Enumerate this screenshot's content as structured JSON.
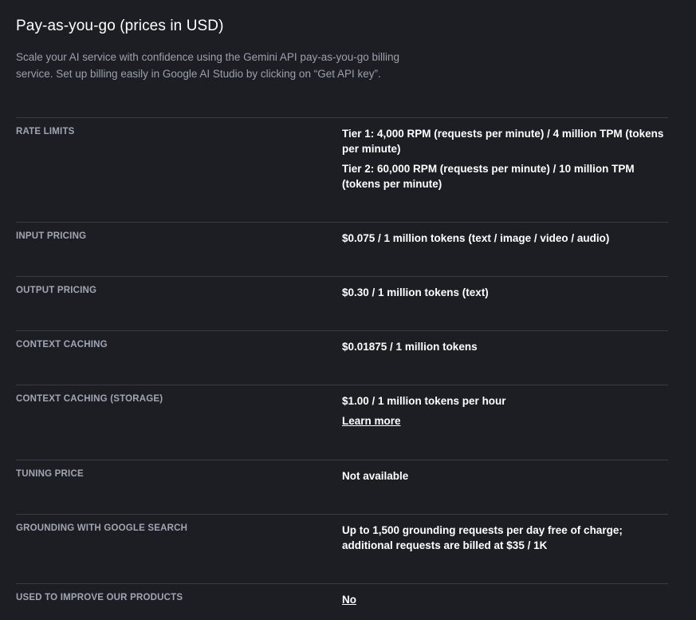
{
  "header": {
    "title": "Pay-as-you-go (prices in USD)",
    "intro": "Scale your AI service with confidence using the Gemini API pay-as-you-go billing service. Set up billing easily in Google AI Studio by clicking on “Get API key”."
  },
  "rows": {
    "rate_limits": {
      "label": "RATE LIMITS",
      "tier1": "Tier 1: 4,000 RPM (requests per minute) / 4 million TPM (tokens per minute)",
      "tier2": "Tier 2: 60,000 RPM (requests per minute) / 10 million TPM (tokens per minute)"
    },
    "input_pricing": {
      "label": "INPUT PRICING",
      "value": "$0.075 / 1 million tokens (text / image / video / audio)"
    },
    "output_pricing": {
      "label": "OUTPUT PRICING",
      "value": "$0.30 / 1 million tokens (text)"
    },
    "context_caching": {
      "label": "CONTEXT CACHING",
      "value": "$0.01875 / 1 million tokens"
    },
    "context_caching_storage": {
      "label": "CONTEXT CACHING (STORAGE)",
      "value": "$1.00 / 1 million tokens per hour",
      "link": "Learn more"
    },
    "tuning_price": {
      "label": "TUNING PRICE",
      "value": "Not available"
    },
    "grounding": {
      "label": "GROUNDING WITH GOOGLE SEARCH",
      "value": "Up to 1,500 grounding requests per day free of charge; additional requests are billed at $35 / 1K"
    },
    "improve_products": {
      "label": "USED TO IMPROVE OUR PRODUCTS",
      "link": "No"
    }
  },
  "colors": {
    "background": "#1d1e24",
    "label": "#a0a6b3",
    "intro": "#9aa0ad",
    "divider": "#3a3c44",
    "text": "#ffffff"
  }
}
